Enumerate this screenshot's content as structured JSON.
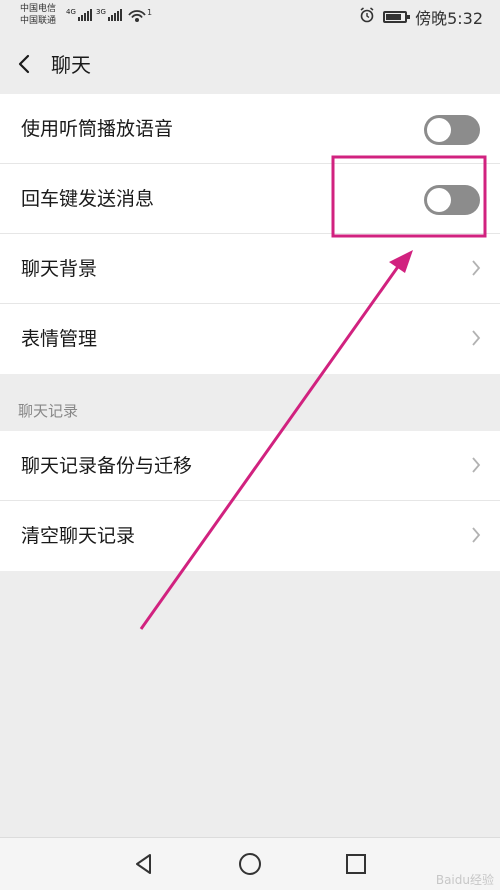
{
  "status_bar": {
    "carrier_1": "中国电信",
    "carrier_2": "中国联通",
    "network_1": "4G",
    "network_2": "3G",
    "wifi_badge": "1",
    "time": "傍晚5:32",
    "icons": [
      "signal-icon",
      "wifi-icon",
      "alarm-icon",
      "battery-icon"
    ],
    "battery_level": 0.85
  },
  "header": {
    "title": "聊天"
  },
  "settings": {
    "rows": [
      {
        "label": "使用听筒播放语音",
        "control": "toggle",
        "on": false
      },
      {
        "label": "回车键发送消息",
        "control": "toggle",
        "on": false
      },
      {
        "label": "聊天背景",
        "control": "chevron"
      },
      {
        "label": "表情管理",
        "control": "chevron"
      }
    ]
  },
  "chat_records": {
    "section_title": "聊天记录",
    "rows": [
      {
        "label": "聊天记录备份与迁移",
        "control": "chevron"
      },
      {
        "label": "清空聊天记录",
        "control": "chevron"
      }
    ]
  },
  "annotation": {
    "color": "#d1227f"
  },
  "nav_bar": {
    "icons": [
      "back-triangle-icon",
      "home-circle-icon",
      "recents-square-icon"
    ]
  },
  "watermark": "Baidu经验"
}
